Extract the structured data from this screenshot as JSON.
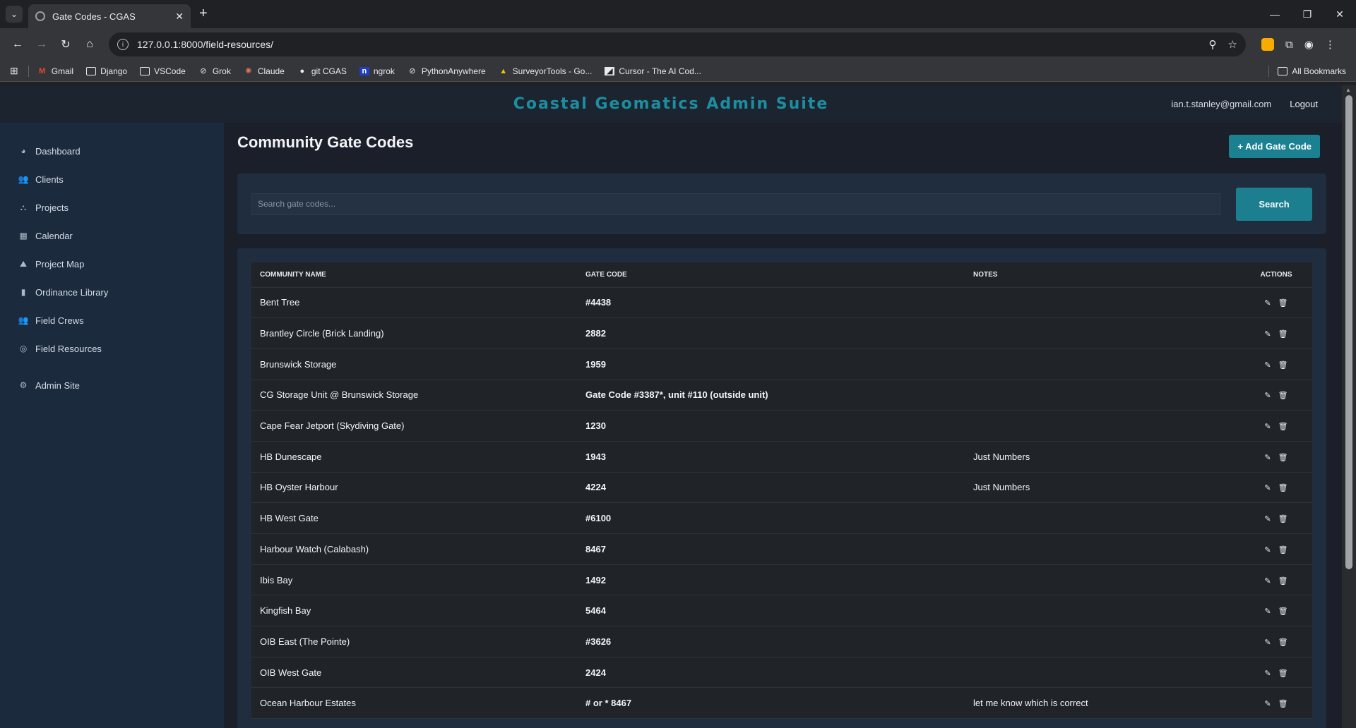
{
  "browser": {
    "tab_title": "Gate Codes - CGAS",
    "url": "127.0.0.1:8000/field-resources/",
    "bookmarks": [
      {
        "label": "Gmail",
        "icon": "gmail-icon"
      },
      {
        "label": "Django",
        "icon": "folder-icon"
      },
      {
        "label": "VSCode",
        "icon": "folder-icon"
      },
      {
        "label": "Grok",
        "icon": "grok-icon"
      },
      {
        "label": "Claude",
        "icon": "claude-icon"
      },
      {
        "label": "git CGAS",
        "icon": "github-icon"
      },
      {
        "label": "ngrok",
        "icon": "ngrok-icon"
      },
      {
        "label": "PythonAnywhere",
        "icon": "pythonanywhere-icon"
      },
      {
        "label": "SurveyorTools - Go...",
        "icon": "drive-icon"
      },
      {
        "label": "Cursor - The AI Cod...",
        "icon": "cursor-icon"
      }
    ],
    "all_bookmarks": "All Bookmarks"
  },
  "header": {
    "brand": "Coastal Geomatics Admin Suite",
    "email": "ian.t.stanley@gmail.com",
    "logout": "Logout"
  },
  "sidebar": {
    "items": [
      {
        "label": "Dashboard",
        "icon": "dashboard-icon"
      },
      {
        "label": "Clients",
        "icon": "users-icon"
      },
      {
        "label": "Projects",
        "icon": "project-diagram-icon"
      },
      {
        "label": "Calendar",
        "icon": "calendar-icon"
      },
      {
        "label": "Project Map",
        "icon": "map-icon"
      },
      {
        "label": "Ordinance Library",
        "icon": "book-icon"
      },
      {
        "label": "Field Crews",
        "icon": "users-icon"
      },
      {
        "label": "Field Resources",
        "icon": "compass-icon"
      }
    ],
    "admin": {
      "label": "Admin Site",
      "icon": "gear-icon"
    }
  },
  "main": {
    "title": "Community Gate Codes",
    "add_button": "+ Add Gate Code",
    "search_placeholder": "Search gate codes...",
    "search_button": "Search",
    "table": {
      "headers": [
        "COMMUNITY NAME",
        "GATE CODE",
        "NOTES",
        "ACTIONS"
      ],
      "rows": [
        {
          "name": "Bent Tree",
          "code": "#4438",
          "notes": ""
        },
        {
          "name": "Brantley Circle (Brick Landing)",
          "code": "2882",
          "notes": ""
        },
        {
          "name": "Brunswick Storage",
          "code": "1959",
          "notes": ""
        },
        {
          "name": "CG Storage Unit @ Brunswick Storage",
          "code": "Gate Code #3387*, unit #110 (outside unit)",
          "notes": ""
        },
        {
          "name": "Cape Fear Jetport (Skydiving Gate)",
          "code": "1230",
          "notes": ""
        },
        {
          "name": "HB Dunescape",
          "code": "1943",
          "notes": "Just Numbers"
        },
        {
          "name": "HB Oyster Harbour",
          "code": "4224",
          "notes": "Just Numbers"
        },
        {
          "name": "HB West Gate",
          "code": "#6100",
          "notes": ""
        },
        {
          "name": "Harbour Watch (Calabash)",
          "code": "8467",
          "notes": ""
        },
        {
          "name": "Ibis Bay",
          "code": "1492",
          "notes": ""
        },
        {
          "name": "Kingfish Bay",
          "code": "5464",
          "notes": ""
        },
        {
          "name": "OIB East (The Pointe)",
          "code": "#3626",
          "notes": ""
        },
        {
          "name": "OIB West Gate",
          "code": "2424",
          "notes": ""
        },
        {
          "name": "Ocean Harbour Estates",
          "code": "# or * 8467",
          "notes": "let me know which is correct"
        }
      ]
    }
  },
  "colors": {
    "brand": "#1b8fa1",
    "button": "#1b8190",
    "sidebar_bg": "#1c2a3d",
    "card_bg": "#1f2d3e"
  }
}
